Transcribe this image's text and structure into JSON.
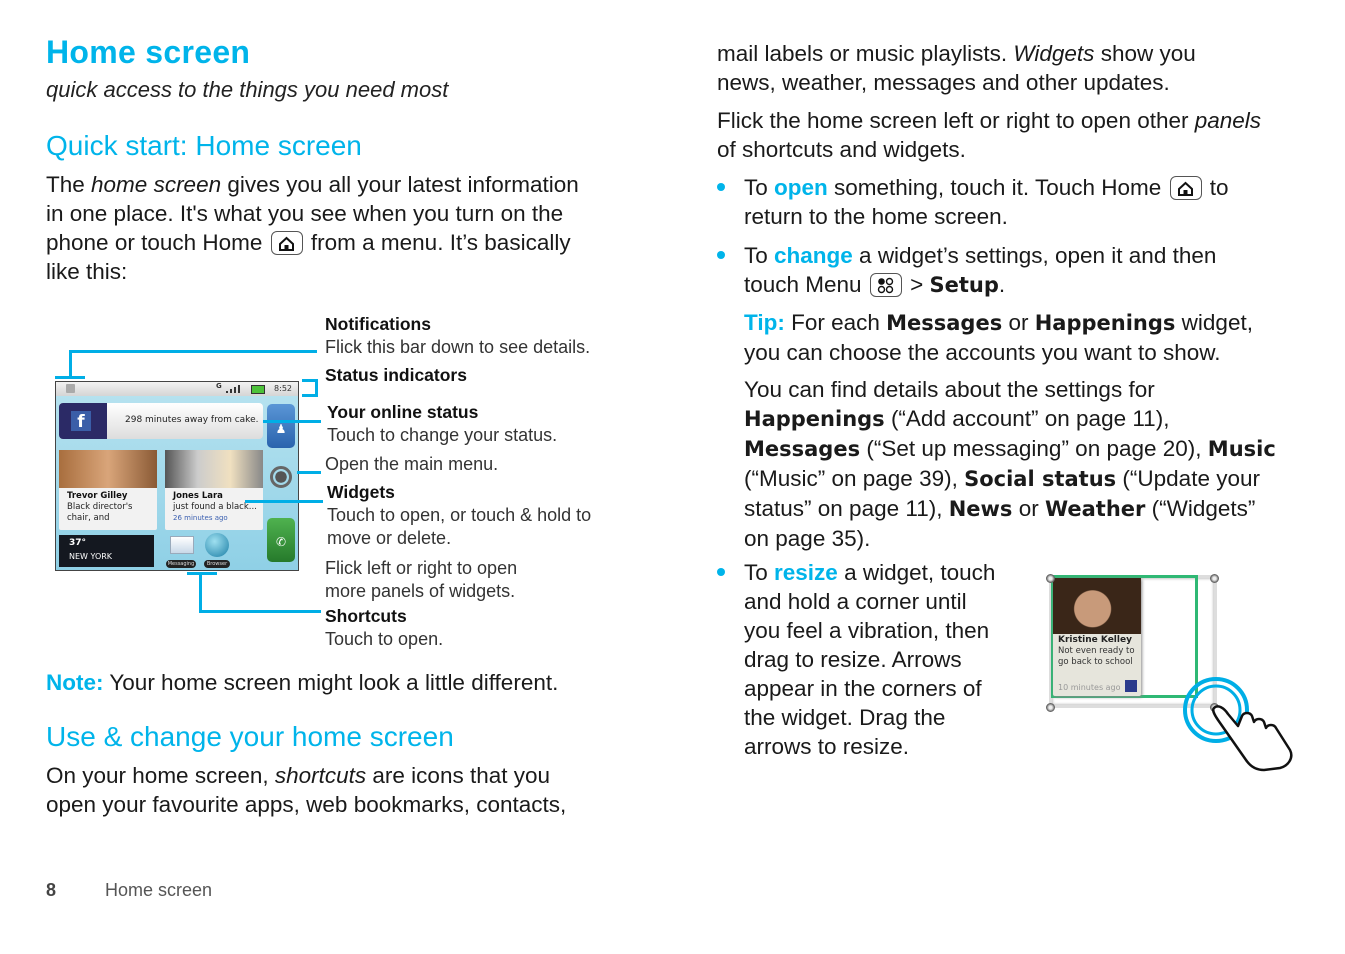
{
  "page": {
    "title": "Home screen",
    "subtitle": "quick access to the things you need most",
    "footer": {
      "page_number": "8",
      "section": "Home screen"
    }
  },
  "left": {
    "quick_start": {
      "heading": "Quick start: Home screen",
      "p_1": "The ",
      "p_em": "home screen",
      "p_2": " gives you all your latest information",
      "p_line2": "in one place. It's what you see when you turn on the",
      "p_line3a": "phone or touch Home ",
      "p_line3b": " from a menu. It’s basically",
      "p_line4": "like this:"
    },
    "phone": {
      "time": "8:52",
      "network": "G",
      "status_message": "298 minutes away from cake.",
      "widgets": [
        {
          "name": "Trevor Gilley",
          "text": "Black director's chair, and",
          "time": ""
        },
        {
          "name": "Jones Lara",
          "text": "just found a black...",
          "time": "26 minutes ago"
        }
      ],
      "weather": {
        "temp": "37°",
        "city": "NEW YORK"
      },
      "shortcuts": [
        "Messaging",
        "Browser"
      ]
    },
    "callouts": {
      "notifications_title": "Notifications",
      "notifications_text": "Flick this bar down to see details.",
      "status_title": "Status indicators",
      "online_title": "Your online status",
      "online_text": "Touch to change your status.",
      "menu_text": "Open the main menu.",
      "widgets_title": "Widgets",
      "widgets_text_1": "Touch to open, or touch & hold to",
      "widgets_text_2": "move or delete.",
      "flick_text_1": "Flick left or right to open",
      "flick_text_2": "more panels of widgets.",
      "shortcuts_title": "Shortcuts",
      "shortcuts_text": "Touch to open."
    },
    "note": {
      "label": "Note:",
      "text": " Your home screen might look a little different."
    },
    "use_change": {
      "heading": "Use & change your home screen",
      "l1a": "On your home screen, ",
      "l1em": "shortcuts",
      "l1b": " are icons that you",
      "l2": "open your favourite apps, web bookmarks, contacts,"
    }
  },
  "right": {
    "p1_l1a": "mail labels or music playlists. ",
    "p1_l1em": "Widgets",
    "p1_l1b": " show you",
    "p1_l2": "news, weather, messages and other updates.",
    "p2_l1a": "Flick the home screen left or right to open other ",
    "p2_l1em": "panels",
    "p2_l2": "of shortcuts and widgets.",
    "b1_a": "To ",
    "b1_key": "open",
    "b1_b": " something, touch it. Touch Home ",
    "b1_c": " to",
    "b1_l2": "return to the home screen.",
    "b2_a": "To ",
    "b2_key": "change",
    "b2_b": " a widget’s settings, open it and then",
    "b2_l2a": "touch Menu ",
    "b2_l2b": " > ",
    "b2_setup": "Setup",
    "b2_l2c": ".",
    "tip_label": "Tip:",
    "tip_a": " For each ",
    "tip_messages": "Messages",
    "tip_or": " or ",
    "tip_happenings": "Happenings",
    "tip_b": " widget,",
    "tip_l2": "you can choose the accounts you want to show.",
    "det_l1": "You can find details about the settings for",
    "det_happenings": "Happenings",
    "det_l2b": " (“Add account” on page 11),",
    "det_messages": "Messages",
    "det_l3b": " (“Set up messaging” on page 20), ",
    "det_music": "Music",
    "det_l4a": "(“Music” on page 39), ",
    "det_social": "Social status",
    "det_l4b": " (“Update your",
    "det_l5a": "status” on page 11), ",
    "det_news": "News",
    "det_or": " or ",
    "det_weather": "Weather",
    "det_l5b": " (“Widgets”",
    "det_l6": "on page 35).",
    "b3_a": "To ",
    "b3_key": "resize",
    "b3_b": " a widget, touch",
    "b3_lines": [
      "and hold a corner until",
      "you feel a vibration, then",
      "drag to resize. Arrows",
      "appear in the corners of",
      "the widget. Drag the",
      "arrows to resize."
    ],
    "widget_example": {
      "name": "Kristine Kelley",
      "text": "Not even ready to go back to school",
      "time": "10 minutes ago"
    }
  }
}
